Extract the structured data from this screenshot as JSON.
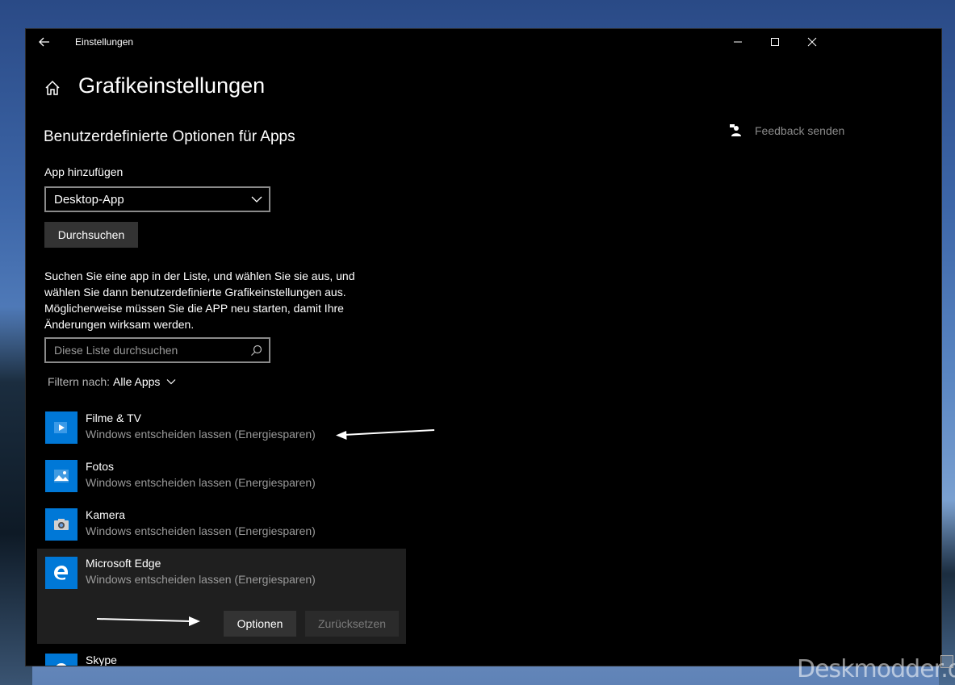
{
  "window": {
    "title": "Einstellungen",
    "back_icon": "back-arrow-icon",
    "controls": [
      "minimize-icon",
      "maximize-icon",
      "close-icon"
    ]
  },
  "page": {
    "title": "Grafikeinstellungen",
    "home_icon": "home-icon"
  },
  "feedback": {
    "label": "Feedback senden",
    "icon": "feedback-icon"
  },
  "section": {
    "title": "Benutzerdefinierte Optionen für Apps",
    "add_label": "App hinzufügen",
    "dropdown_value": "Desktop-App",
    "browse_label": "Durchsuchen",
    "description": "Suchen Sie eine app in der Liste, und wählen Sie sie aus, und wählen Sie dann benutzerdefinierte Grafikeinstellungen aus. Möglicherweise müssen Sie die APP neu starten, damit Ihre Änderungen wirksam werden.",
    "search_placeholder": "Diese Liste durchsuchen",
    "filter_label": "Filtern nach:",
    "filter_value": "Alle Apps"
  },
  "apps": [
    {
      "name": "Filme & TV",
      "setting": "Windows entscheiden lassen (Energiesparen)",
      "icon": "film-tv-icon"
    },
    {
      "name": "Fotos",
      "setting": "Windows entscheiden lassen (Energiesparen)",
      "icon": "photos-icon"
    },
    {
      "name": "Kamera",
      "setting": "Windows entscheiden lassen (Energiesparen)",
      "icon": "camera-icon"
    },
    {
      "name": "Microsoft Edge",
      "setting": "Windows entscheiden lassen (Energiesparen)",
      "icon": "edge-icon"
    },
    {
      "name": "Skype",
      "setting": "",
      "icon": "skype-icon"
    }
  ],
  "selected_actions": {
    "options_label": "Optionen",
    "reset_label": "Zurücksetzen"
  },
  "watermark": "Deskmodder.de",
  "colors": {
    "accent": "#0078d7",
    "window_bg": "#000000",
    "button_bg": "#333333",
    "secondary_text": "#9a9a9a"
  }
}
